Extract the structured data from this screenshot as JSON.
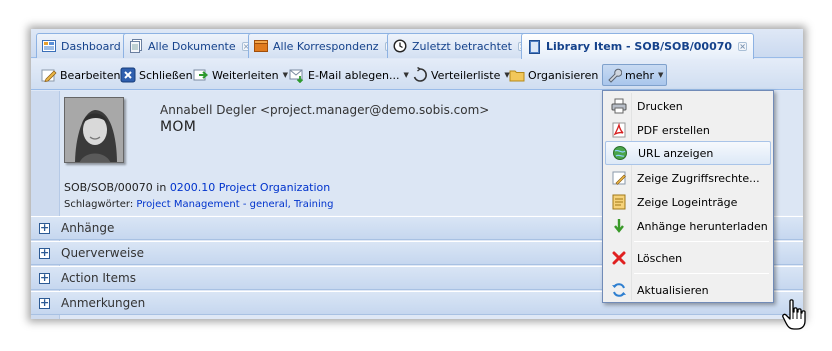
{
  "tabs": [
    {
      "label": "Dashboard",
      "icon": "dashboard-icon",
      "closable": false,
      "active": false
    },
    {
      "label": "Alle Dokumente",
      "icon": "documents-icon",
      "closable": true,
      "active": false
    },
    {
      "label": "Alle Korrespondenz",
      "icon": "correspondence-icon",
      "closable": true,
      "active": false
    },
    {
      "label": "Zuletzt betrachtet",
      "icon": "history-icon",
      "closable": true,
      "active": false
    },
    {
      "label": "Library Item - SOB/SOB/00070",
      "icon": "library-item-icon",
      "closable": true,
      "active": true
    }
  ],
  "toolbar": {
    "edit": "Bearbeiten",
    "close": "Schließen",
    "forward": "Weiterleiten",
    "email_file": "E-Mail ablegen...",
    "distribution": "Verteilerliste",
    "organize": "Organisieren",
    "more": "mehr"
  },
  "document": {
    "author": "Annabell Degler <project.manager@demo.sobis.com>",
    "subject": "MOM",
    "id": "SOB/SOB/00070",
    "in_label": "in",
    "project_link": "0200.10 Project Organization",
    "keywords_label": "Schlagwörter:",
    "keywords": "Project Management - general, Training"
  },
  "sections": [
    "Anhänge",
    "Querverweise",
    "Action Items",
    "Anmerkungen"
  ],
  "menu": {
    "items": [
      {
        "label": "Drucken",
        "icon": "printer-icon"
      },
      {
        "label": "PDF erstellen",
        "icon": "pdf-icon"
      },
      {
        "label": "URL anzeigen",
        "icon": "url-globe-icon",
        "highlighted": true
      },
      {
        "label": "Zeige Zugriffsrechte...",
        "icon": "permissions-icon"
      },
      {
        "label": "Zeige Logeinträge",
        "icon": "log-icon"
      },
      {
        "label": "Anhänge herunterladen",
        "icon": "download-arrow-icon"
      },
      {
        "label": "Löschen",
        "icon": "delete-x-icon"
      },
      {
        "label": "Aktualisieren",
        "icon": "refresh-icon"
      }
    ]
  },
  "colors": {
    "panel_bg": "#dfe8f6",
    "tab_text": "#15428b",
    "link": "#0033cc",
    "delete_red": "#e02020",
    "download_green": "#3a9a2a"
  }
}
